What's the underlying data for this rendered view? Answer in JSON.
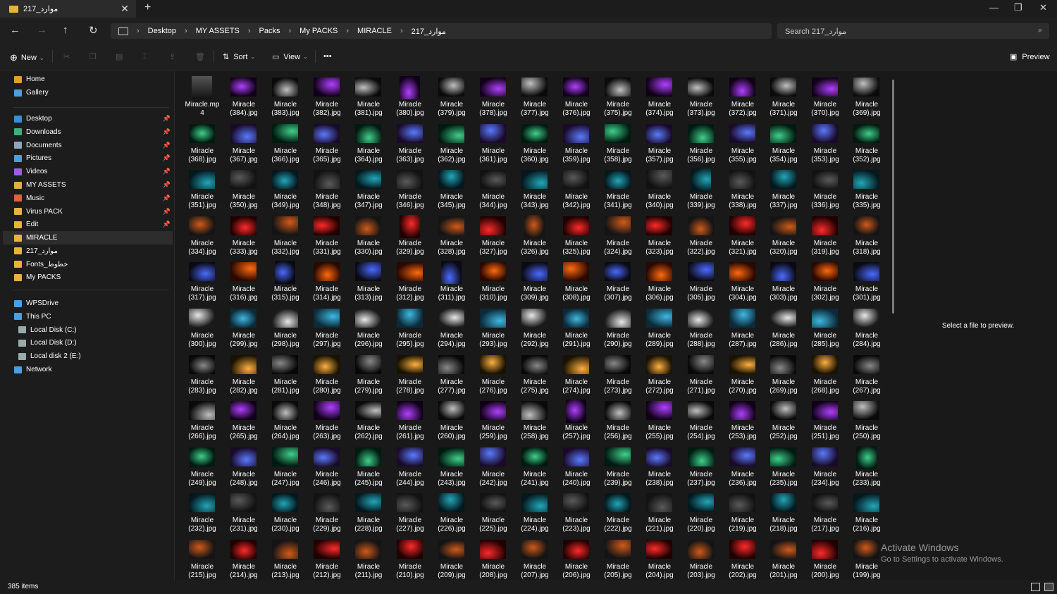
{
  "window": {
    "tab_title": "217_موارد",
    "tab_close": "✕",
    "new_tab": "+",
    "minimize": "—",
    "maximize": "❐",
    "close": "✕"
  },
  "nav": {
    "back": "←",
    "forward": "→",
    "up": "↑",
    "refresh": "↻",
    "breadcrumb": [
      "Desktop",
      "MY ASSETS",
      "Packs",
      "My PACKS",
      "MIRACLE",
      "217_موارد"
    ],
    "search_placeholder": "Search 217_موارد"
  },
  "toolbar": {
    "new_label": "New",
    "sort_label": "Sort",
    "view_label": "View",
    "more": "•••",
    "preview_label": "Preview"
  },
  "sidebar": {
    "quick": [
      {
        "label": "Home",
        "color": "#e0a030"
      },
      {
        "label": "Gallery",
        "color": "#4a9fe0"
      }
    ],
    "pinned": [
      {
        "label": "Desktop",
        "color": "#3a8ed8"
      },
      {
        "label": "Downloads",
        "color": "#3cb07a"
      },
      {
        "label": "Documents",
        "color": "#8fa4c0"
      },
      {
        "label": "Pictures",
        "color": "#4a9fe0"
      },
      {
        "label": "Videos",
        "color": "#9b5de5"
      },
      {
        "label": "MY ASSETS",
        "color": "#e0b040"
      },
      {
        "label": "Music",
        "color": "#e0603a"
      },
      {
        "label": "Virus PACK",
        "color": "#e8b33d"
      },
      {
        "label": "Edit",
        "color": "#e8b33d"
      }
    ],
    "folders": [
      {
        "label": "MIRACLE",
        "color": "#e8b33d"
      },
      {
        "label": "217_موارد",
        "color": "#e8b33d"
      },
      {
        "label": "Fonts_خطوط",
        "color": "#e8b33d"
      },
      {
        "label": "My PACKS",
        "color": "#e8b33d"
      }
    ],
    "drives": [
      {
        "label": "WPSDrive",
        "color": "#4a9fe0",
        "indent": 0
      },
      {
        "label": "This PC",
        "color": "#4a9fe0",
        "indent": 0
      },
      {
        "label": "Local Disk (C:)",
        "color": "#9aa",
        "indent": 1
      },
      {
        "label": "Local Disk (D:)",
        "color": "#9aa",
        "indent": 1
      },
      {
        "label": "Local disk 2 (E:)",
        "color": "#9aa",
        "indent": 1
      },
      {
        "label": "Network",
        "color": "#4a9fe0",
        "indent": 0
      }
    ]
  },
  "files": {
    "first": {
      "line1": "Miracle.mp",
      "line2": "4"
    },
    "prefix": "Miracle",
    "range_from": 384,
    "range_to": 199
  },
  "preview_pane": {
    "message": "Select a file to preview."
  },
  "watermark": {
    "title": "Activate Windows",
    "subtitle": "Go to Settings to activate Windows."
  },
  "status": {
    "item_count": "385 items"
  }
}
